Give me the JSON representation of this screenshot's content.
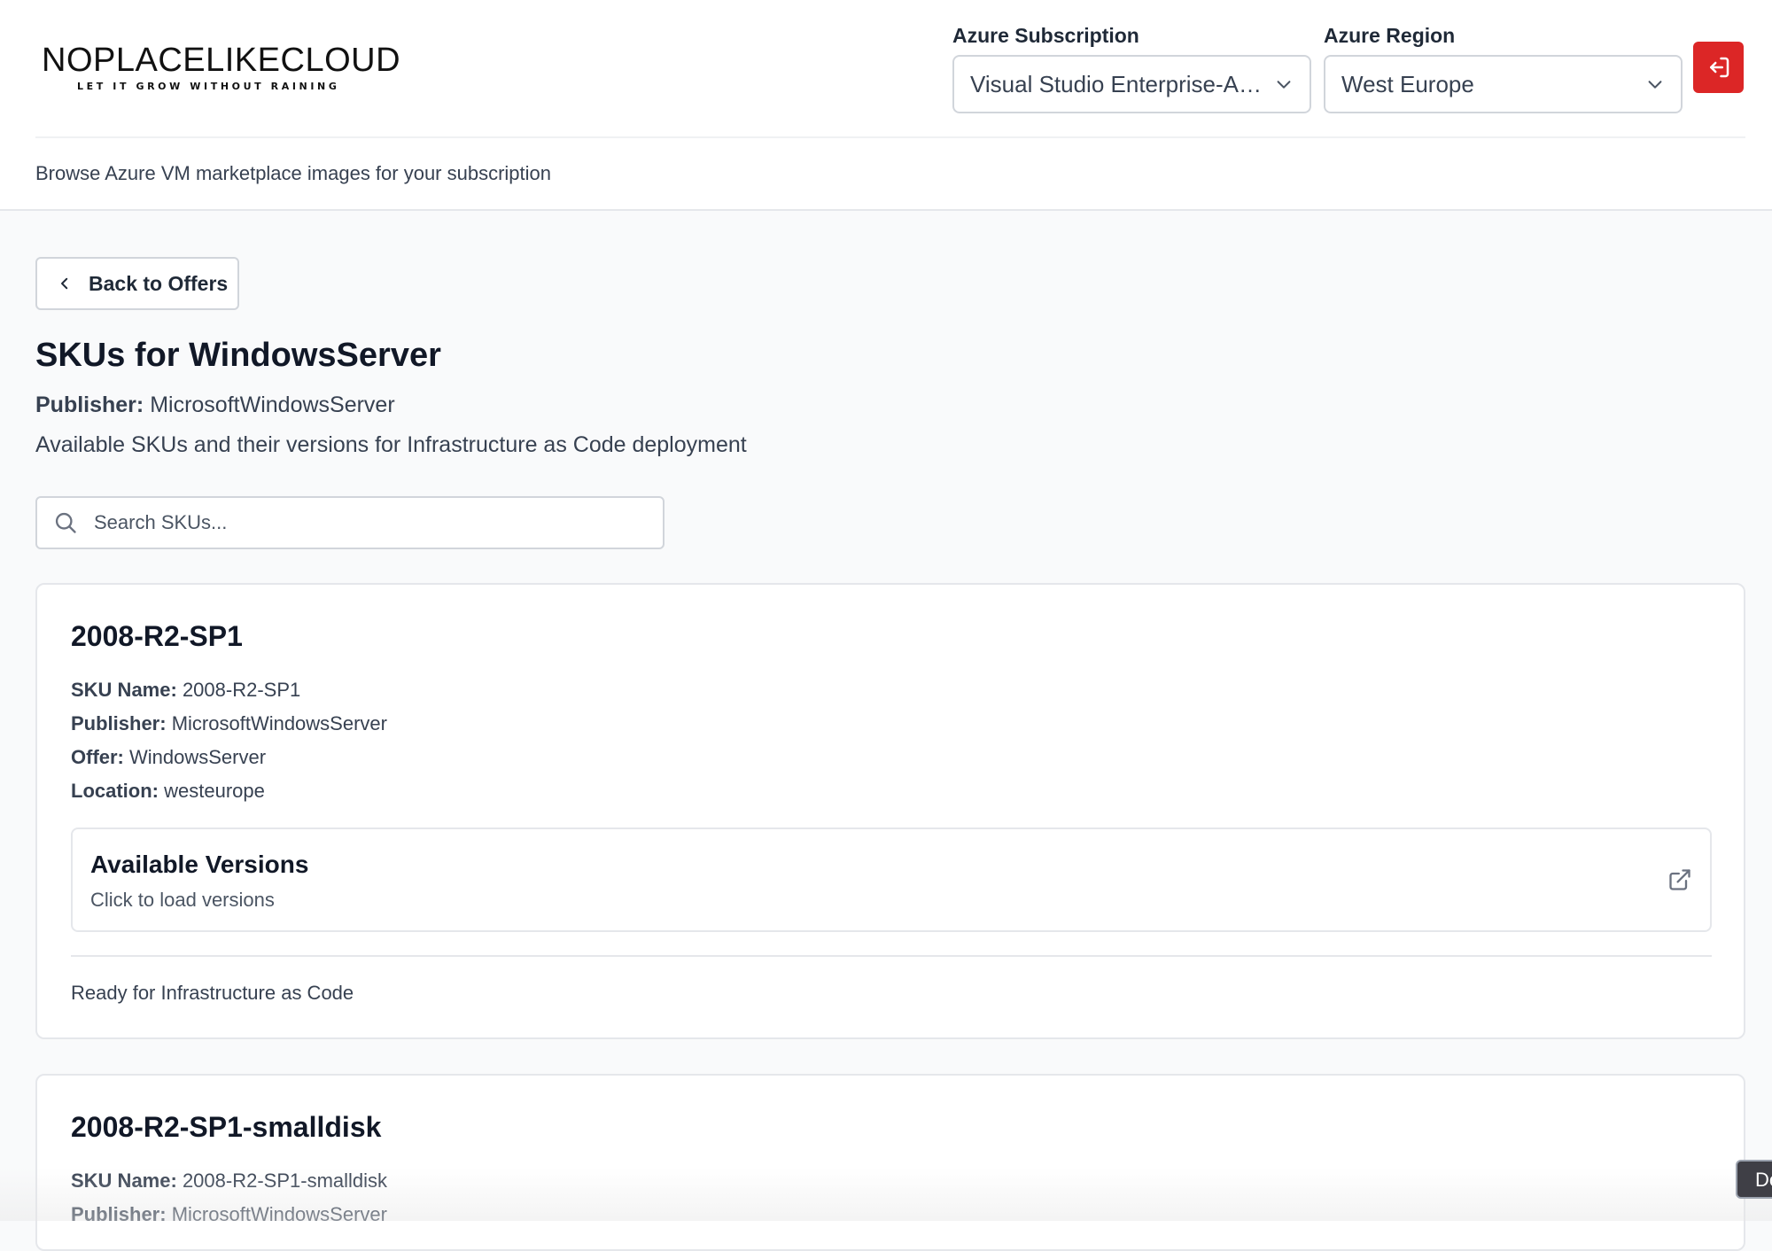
{
  "brand": {
    "name": "NOPLACELIKECLOUD",
    "tagline": "LET IT GROW WITHOUT RAINING"
  },
  "header": {
    "subscription_label": "Azure Subscription",
    "subscription_value": "Visual Studio Enterprise-Ab...",
    "region_label": "Azure Region",
    "region_value": "West Europe",
    "logout_icon": "logout-icon",
    "subtitle": "Browse Azure VM marketplace images for your subscription"
  },
  "main": {
    "back_label": "Back to Offers",
    "title": "SKUs for WindowsServer",
    "publisher_label": "Publisher:",
    "publisher_value": "MicrosoftWindowsServer",
    "description": "Available SKUs and their versions for Infrastructure as Code deployment",
    "search_placeholder": "Search SKUs..."
  },
  "skus": [
    {
      "title": "2008-R2-SP1",
      "sku_label": "SKU Name:",
      "sku_value": "2008-R2-SP1",
      "publisher_label": "Publisher:",
      "publisher_value": "MicrosoftWindowsServer",
      "offer_label": "Offer:",
      "offer_value": "WindowsServer",
      "location_label": "Location:",
      "location_value": "westeurope",
      "versions_title": "Available Versions",
      "versions_sub": "Click to load versions",
      "footer": "Ready for Infrastructure as Code"
    },
    {
      "title": "2008-R2-SP1-smalldisk",
      "sku_label": "SKU Name:",
      "sku_value": "2008-R2-SP1-smalldisk",
      "publisher_label": "Publisher:",
      "publisher_value": "MicrosoftWindowsServer"
    }
  ],
  "dev_badge": "De",
  "colors": {
    "accent_red": "#dc2626",
    "page_bg": "#f9fafb",
    "border": "#e5e7eb"
  }
}
